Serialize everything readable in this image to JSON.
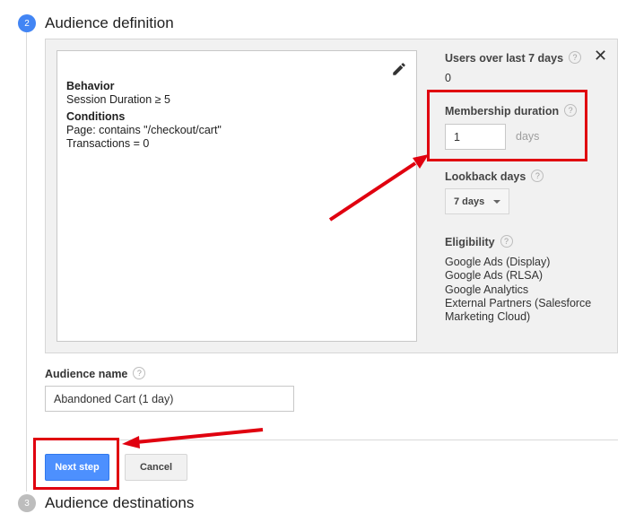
{
  "steps": {
    "current": {
      "number": "2",
      "title": "Audience definition"
    },
    "next": {
      "number": "3",
      "title": "Audience destinations"
    }
  },
  "definition": {
    "behavior_label": "Behavior",
    "behavior_value": "Session Duration ≥ 5",
    "conditions_label": "Conditions",
    "condition_1": "Page: contains \"/checkout/cart\"",
    "condition_2": "Transactions = 0"
  },
  "side_panel": {
    "users_label": "Users over last 7 days",
    "users_value": "0",
    "membership_label": "Membership duration",
    "membership_value": "1",
    "membership_unit": "days",
    "lookback_label": "Lookback days",
    "lookback_value": "7 days",
    "eligibility_label": "Eligibility",
    "eligibility": [
      "Google Ads (Display)",
      "Google Ads (RLSA)",
      "Google Analytics",
      "External Partners (Salesforce Marketing Cloud)"
    ],
    "help_glyph": "?",
    "close_glyph": "✕"
  },
  "audience_name": {
    "label": "Audience name",
    "value": "Abandoned Cart (1 day)"
  },
  "buttons": {
    "next": "Next step",
    "cancel": "Cancel"
  },
  "colors": {
    "accent": "#4285f4",
    "primary_button": "#4d90fe",
    "annotation": "#e0000f"
  },
  "icons": {
    "edit": "pencil-icon",
    "close": "close-icon",
    "help": "help-icon",
    "dropdown": "chevron-down-icon"
  }
}
